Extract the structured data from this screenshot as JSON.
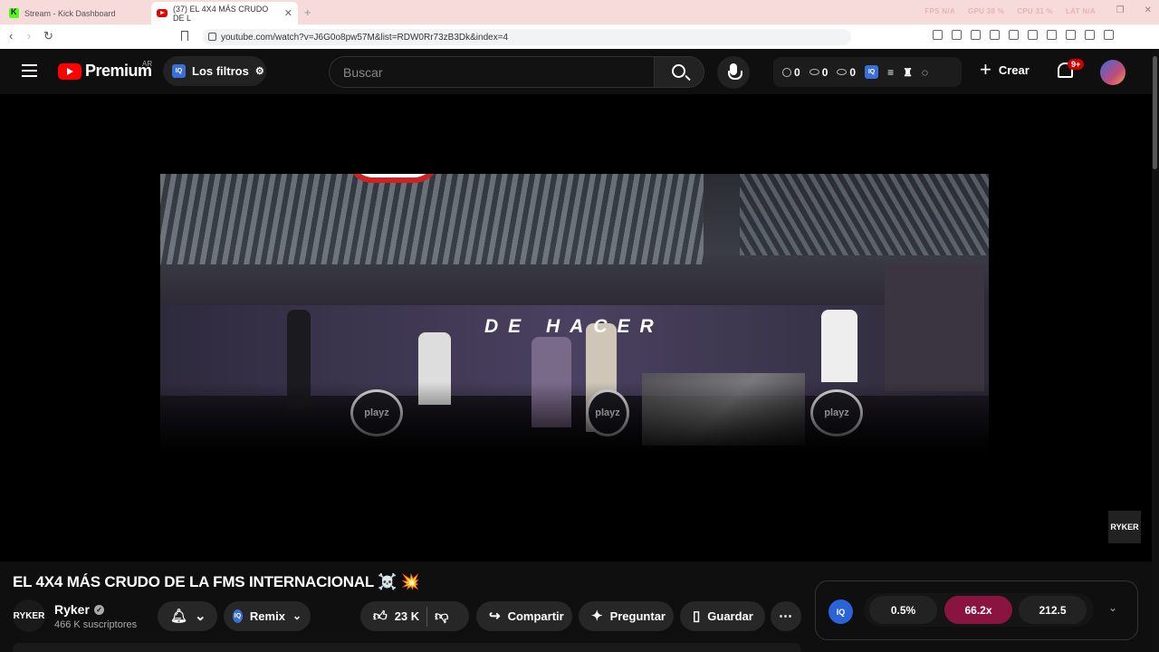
{
  "browser": {
    "tabs": [
      {
        "title": "Stream - Kick Dashboard"
      },
      {
        "title": "(37) EL 4X4 MÁS CRUDO DE L"
      }
    ],
    "stats": [
      "FPS N/A",
      "GPU 38 %",
      "CPU 31 %",
      "LAT N/A"
    ],
    "url": "youtube.com/watch?v=J6G0o8pw57M&list=RDW0Rr73zB3Dk&index=4"
  },
  "header": {
    "logo_text": "Premium",
    "country": "AR",
    "filters_label": "Los filtros",
    "search_placeholder": "Buscar",
    "counters": [
      "0",
      "0",
      "0"
    ],
    "iq_label": "IQ",
    "create_label": "Crear",
    "notif_badge": "9+"
  },
  "video": {
    "overlay_text": "DE HACER",
    "watermark": "RYKER",
    "playz": "playz"
  },
  "meta": {
    "title": "EL 4X4 MÁS CRUDO DE LA FMS INTERNACIONAL ☠️ 💥",
    "channel_avatar": "RYKER",
    "channel_name": "Ryker",
    "subscribers": "466 K suscriptores",
    "remix_label": "Remix",
    "likes": "23 K",
    "share_label": "Compartir",
    "ask_label": "Preguntar",
    "save_label": "Guardar"
  },
  "iq_panel": {
    "badge": "IQ",
    "metrics": [
      "0.5%",
      "66.2x",
      "212.5"
    ]
  },
  "colors": {
    "accent": "#ff0000",
    "metric_highlight": "#8a1440"
  }
}
